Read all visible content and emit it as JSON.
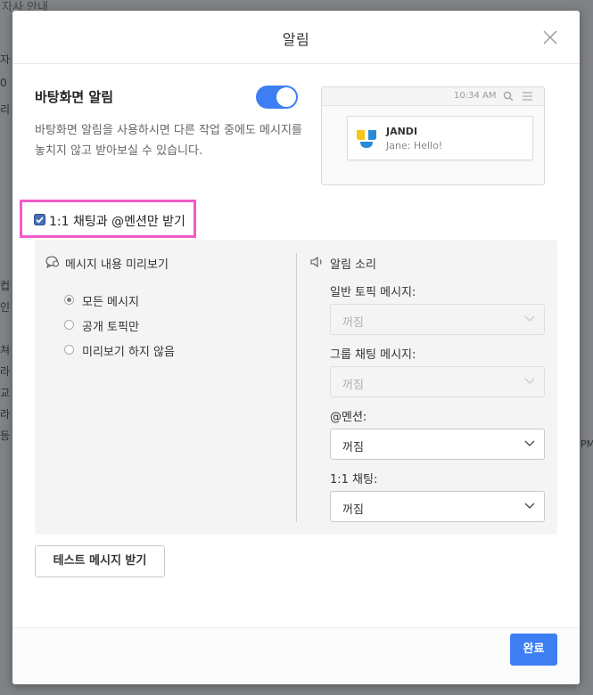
{
  "background": {
    "top_text": "자사 안내",
    "left_chars": [
      "자",
      "0",
      "리",
      "컵",
      "인",
      "쳐",
      "라",
      "교",
      "라",
      "등"
    ],
    "right_text": "PM"
  },
  "modal": {
    "title": "알림",
    "desktop": {
      "title": "바탕화면 알림",
      "description": "바탕화면 알림을 사용하시면 다른 작업 중에도 메시지를 놓치지 않고 받아보실 수 있습니다.",
      "toggle_on": true
    },
    "preview": {
      "time": "10:34 AM",
      "app_name": "JANDI",
      "message": "Jane: Hello!"
    },
    "dm_mention_only": {
      "label": "1:1 채팅과 @멘션만 받기",
      "checked": true
    },
    "message_preview": {
      "title": "메시지 내용 미리보기",
      "options": [
        "모든 메시지",
        "공개 토픽만",
        "미리보기 하지 않음"
      ],
      "selected": "모든 메시지"
    },
    "sound": {
      "title": "알림 소리",
      "fields": [
        {
          "label": "일반 토픽 메시지:",
          "value": "꺼짐",
          "disabled": true
        },
        {
          "label": "그룹 채팅 메시지:",
          "value": "꺼짐",
          "disabled": true
        },
        {
          "label": "@멘션:",
          "value": "꺼짐",
          "disabled": false
        },
        {
          "label": "1:1 채팅:",
          "value": "꺼짐",
          "disabled": false
        }
      ]
    },
    "test_button": "테스트 메시지 받기",
    "done_button": "완료"
  },
  "colors": {
    "accent": "#3d7ff3",
    "highlight": "#f25bc8"
  }
}
